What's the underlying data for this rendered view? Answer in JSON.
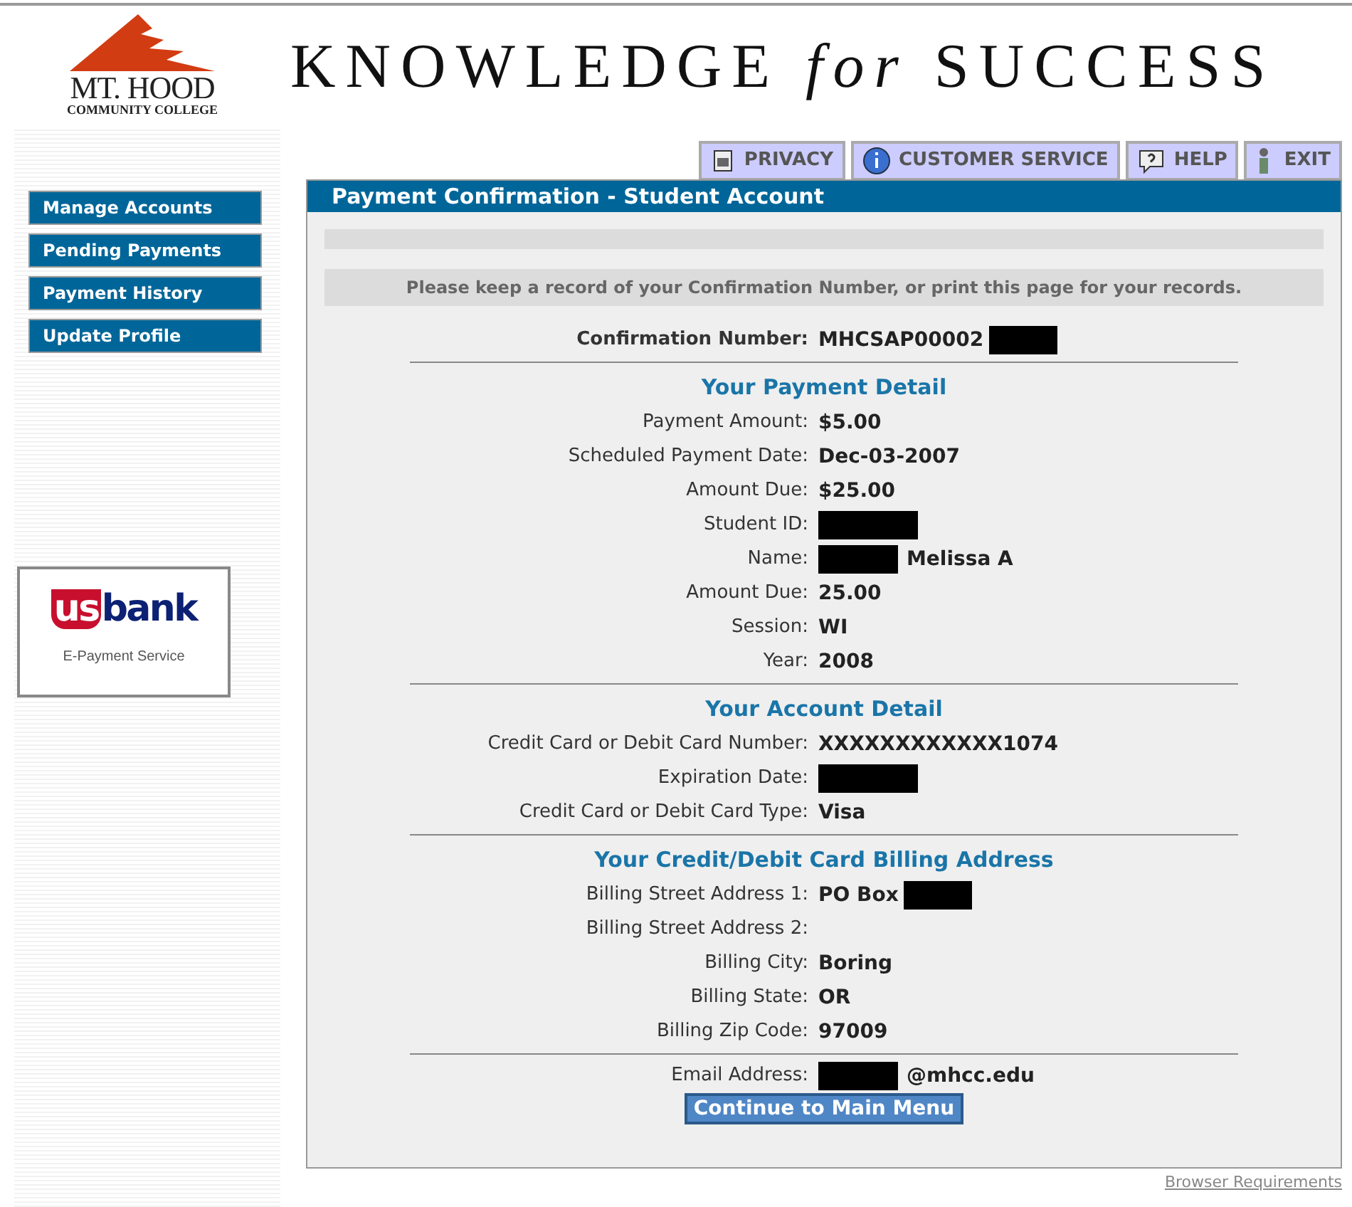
{
  "header": {
    "logo_name": "MT. HOOD",
    "logo_sub": "COMMUNITY COLLEGE",
    "tagline": "KNOWLEDGE *for* SUCCESS"
  },
  "toolbar": [
    {
      "label": "PRIVACY",
      "kind": "privacy"
    },
    {
      "label": "CUSTOMER SERVICE",
      "kind": "info"
    },
    {
      "label": "HELP",
      "kind": "help"
    },
    {
      "label": "EXIT",
      "kind": "exit"
    }
  ],
  "nav": [
    "Manage Accounts",
    "Pending Payments",
    "Payment History",
    "Update Profile"
  ],
  "partner": {
    "brand_left": "us",
    "brand_right": "bank",
    "caption": "E-Payment Service"
  },
  "panel": {
    "title": "Payment Confirmation - Student Account",
    "notice": "Please keep a record of your Confirmation Number, or print this page for your records.",
    "confirmation": {
      "label": "Confirmation Number:",
      "value": "MHCSAP00002",
      "redacted_after": true
    },
    "sections": [
      {
        "heading": "Your Payment Detail",
        "rows": [
          {
            "label": "Payment Amount:",
            "value": "$5.00"
          },
          {
            "label": "Scheduled Payment Date:",
            "value": "Dec-03-2007"
          },
          {
            "label": "Amount Due:",
            "value": "$25.00"
          },
          {
            "label": "Student ID:",
            "redacted_after": true
          },
          {
            "label": "Name:",
            "value": "Melissa A",
            "redacted_before": true
          },
          {
            "label": "Amount Due:",
            "value": "25.00"
          },
          {
            "label": "Session:",
            "value": "WI"
          },
          {
            "label": "Year:",
            "value": "2008"
          }
        ]
      },
      {
        "heading": "Your Account Detail",
        "rows": [
          {
            "label": "Credit Card or Debit Card Number:",
            "value": "XXXXXXXXXXXX1074"
          },
          {
            "label": "Expiration Date:",
            "redacted_after": true
          },
          {
            "label": "Credit Card or Debit Card Type:",
            "value": "Visa"
          }
        ]
      },
      {
        "heading": "Your Credit/Debit Card Billing Address",
        "rows": [
          {
            "label": "Billing Street Address 1:",
            "value": "PO Box",
            "redacted_after": true
          },
          {
            "label": "Billing Street Address 2:"
          },
          {
            "label": "Billing City:",
            "value": "Boring"
          },
          {
            "label": "Billing State:",
            "value": "OR"
          },
          {
            "label": "Billing Zip Code:",
            "value": "97009"
          }
        ]
      }
    ],
    "email": {
      "label": "Email Address:",
      "value": "@mhcc.edu",
      "redacted_before": true
    },
    "button": "Continue to Main Menu"
  },
  "footer_link": "Browser Requirements"
}
